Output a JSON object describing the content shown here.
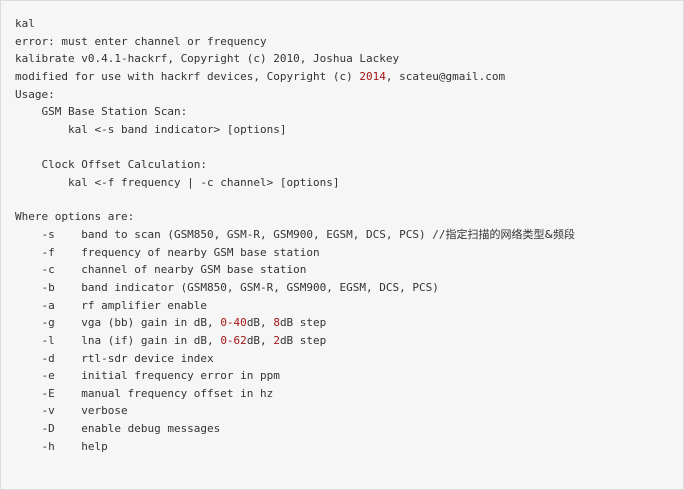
{
  "colors": {
    "background": "#f6f6f6",
    "text": "#333333",
    "number": "#a31515"
  },
  "lines": [
    {
      "text": "kal"
    },
    {
      "text": "error: must enter channel or frequency"
    },
    {
      "text": "kalibrate v0.4.1-hackrf, Copyright (c) 2010, Joshua Lackey"
    },
    {
      "pre": "modified for use with hackrf devices, Copyright (c) ",
      "num": "2014",
      "post": ", scateu@gmail.com"
    },
    {
      "text": "Usage:"
    },
    {
      "text": "    GSM Base Station Scan:"
    },
    {
      "text": "        kal <-s band indicator> [options]"
    },
    {
      "text": "    Clock Offset Calculation:"
    },
    {
      "text": "        kal <-f frequency | -c channel> [options]"
    },
    {
      "text": "Where options are:"
    },
    {
      "pre": "    -s    band to scan (GSM850, GSM-R, GSM900, EGSM, DCS, PCS) //",
      "cjk": "指定扫描的网络类型&频段"
    },
    {
      "text": "    -f    frequency of nearby GSM base station"
    },
    {
      "text": "    -c    channel of nearby GSM base station"
    },
    {
      "text": "    -b    band indicator (GSM850, GSM-R, GSM900, EGSM, DCS, PCS)"
    },
    {
      "text": "    -a    rf amplifier enable"
    },
    {
      "pre": "    -g    vga (bb) gain in dB, ",
      "num": "0-40",
      "mid": "dB, ",
      "num2": "8",
      "post": "dB step"
    },
    {
      "pre": "    -l    lna (if) gain in dB, ",
      "num": "0-62",
      "mid": "dB, ",
      "num2": "2",
      "post": "dB step"
    },
    {
      "text": "    -d    rtl-sdr device index"
    },
    {
      "text": "    -e    initial frequency error in ppm"
    },
    {
      "text": "    -E    manual frequency offset in hz"
    },
    {
      "text": "    -v    verbose"
    },
    {
      "text": "    -D    enable debug messages"
    },
    {
      "text": "    -h    help"
    }
  ]
}
